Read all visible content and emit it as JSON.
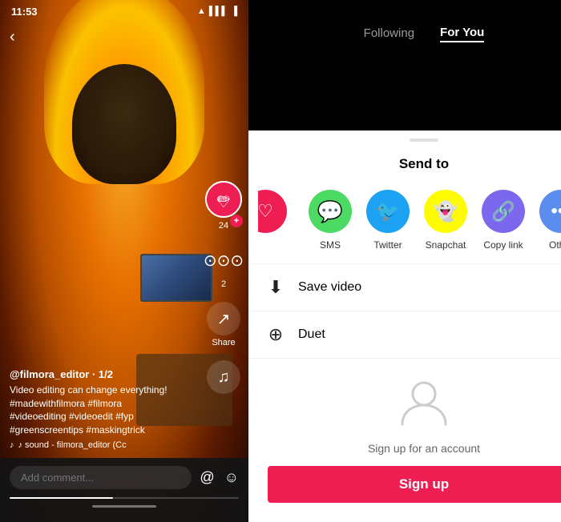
{
  "left": {
    "time": "11:53",
    "back_arrow": "‹",
    "username": "@filmora_editor · 1/2",
    "description": "Video editing can change everything!\n#madewithfilmora #filmora\n#videoediting #videoedit #fyp\n#greenscreentips #maskingtrick",
    "music": "♪ sound - filmora_editor (Cc",
    "comment_placeholder": "Add comment...",
    "share_label": "Share",
    "heart_count": "24",
    "comment_count": "2"
  },
  "right": {
    "nav": {
      "following_label": "Following",
      "for_you_label": "For You"
    },
    "sheet": {
      "title": "Send to",
      "close": "×",
      "share_items": [
        {
          "label": "SMS",
          "color": "sms"
        },
        {
          "label": "Twitter",
          "color": "twitter"
        },
        {
          "label": "Snapchat",
          "color": "snapchat"
        },
        {
          "label": "Copy link",
          "color": "copylink"
        },
        {
          "label": "Other",
          "color": "other"
        }
      ],
      "save_video_label": "Save video",
      "duet_label": "Duet",
      "signup_text": "Sign up for an account",
      "signup_btn": "Sign up"
    }
  }
}
